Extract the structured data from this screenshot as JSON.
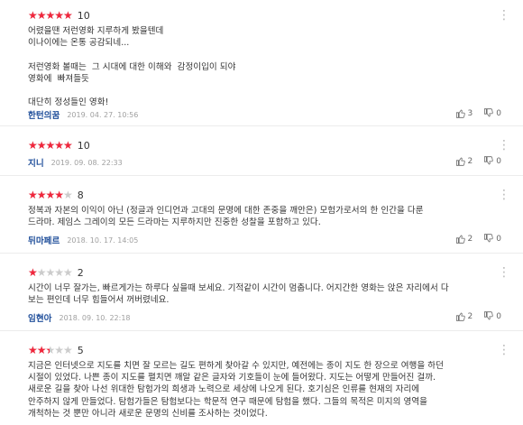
{
  "reviews": [
    {
      "rating": 5,
      "score": "10",
      "text": "어렸을땐 저런영화 지루하게 봤을텐데\n이나이에는 온통 공감되네...\n\n저런영화 볼때는  그 시대에 대한 이해와  감정이입이 되야\n영화에  빠져들듯\n\n대단히 정성들인 영화!",
      "author": "한턴의꿈",
      "date": "2019. 04. 27. 10:56",
      "likes": "3",
      "dislikes": "0"
    },
    {
      "rating": 5,
      "score": "10",
      "text": "",
      "author": "지니",
      "date": "2019. 09. 08. 22:33",
      "likes": "2",
      "dislikes": "0"
    },
    {
      "rating": 4,
      "score": "8",
      "text": "정복과 자본의 이익이 아닌 (정글과 인디언과 고대의 문명에 대한 존중을 깨안은) 모험가로서의 한 인간을 다룬\n드라마. 제임스 그레이의 모든 드라마는 지루하지만 진중한 성찰을 포함하고 있다.",
      "author": "뒤마페르",
      "date": "2018. 10. 17. 14:05",
      "likes": "2",
      "dislikes": "0"
    },
    {
      "rating": 1,
      "score": "2",
      "text": "시간이 너무 잘가는, 빠르게가는 하루다 싶을때 보세요. 기적같이 시간이 멈춥니다. 어지간한 영화는 앉은 자리에서 다\n보는 편인데 너무 힘들어서 꺼버렸네요.",
      "author": "임현아",
      "date": "2018. 09. 10. 22:18",
      "likes": "2",
      "dislikes": "0"
    },
    {
      "rating": 2.5,
      "score": "5",
      "text": "지금은 인터넷으로 지도를 치면 잘 모르는 길도 편하게 찾아갈 수 있지만, 예전에는 종이 지도 한 장으로 여행을 하던\n시절이 있었다. 나쁜 종이 지도를 펼치면 깨알 같은 글자와 기호들이 눈에 들어왔다. 지도는 어떻게 만들어진 걸까.\n새로운 길을 찾아 나선 위대한 탐험가의 희생과 노력으로 세상에 나오게 된다. 호기심은 인류를 현재의 자리에\n안주하지 않게 만들었다. 탐험가들은 탐험보다는 학문적 연구 때문에 탐험을 했다. 그들의 목적은 미지의 영역을\n개척하는 것 뿐만 아니라 새로운 문명의 신비를 조사하는 것이었다.",
      "author": "",
      "date": "",
      "likes": "",
      "dislikes": ""
    }
  ],
  "icons": {
    "star_filled": "star-icon",
    "more": "more-options-icon",
    "like": "thumbs-up-icon",
    "dislike": "thumbs-down-icon"
  },
  "colors": {
    "star": "#f0263c",
    "star_empty": "#cccccc",
    "author": "#1f4e9a",
    "date": "#a0a0a0"
  }
}
